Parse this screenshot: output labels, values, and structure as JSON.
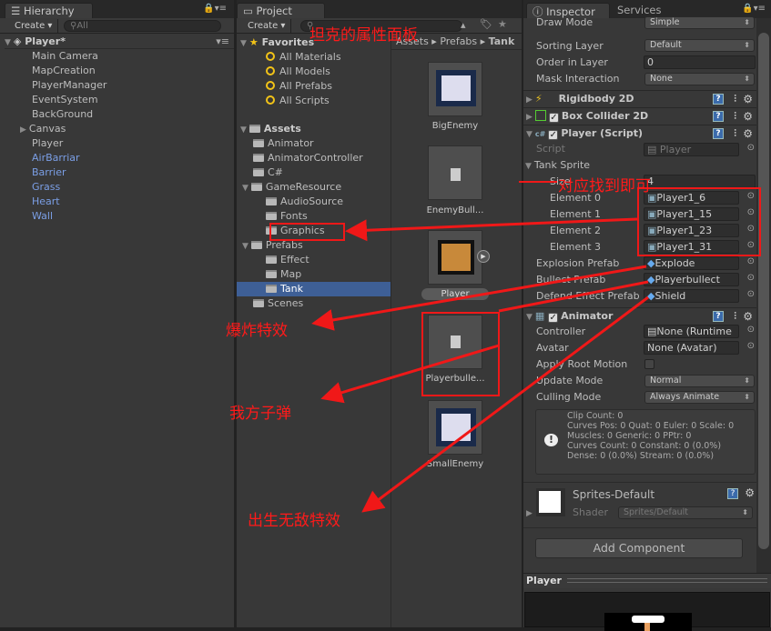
{
  "hierarchy": {
    "tab": "Hierarchy",
    "create": "Create ▾",
    "search_placeholder": "All",
    "scene": "Player*",
    "items": [
      {
        "label": "Main Camera"
      },
      {
        "label": "MapCreation"
      },
      {
        "label": "PlayerManager"
      },
      {
        "label": "EventSystem"
      },
      {
        "label": "BackGround"
      },
      {
        "label": "Canvas",
        "expandable": true
      },
      {
        "label": "Player"
      },
      {
        "label": "AirBarriar",
        "prefab": true
      },
      {
        "label": "Barrier",
        "prefab": true
      },
      {
        "label": "Grass",
        "prefab": true
      },
      {
        "label": "Heart",
        "prefab": true
      },
      {
        "label": "Wall",
        "prefab": true
      }
    ]
  },
  "project": {
    "tab": "Project",
    "create": "Create ▾",
    "favorites": {
      "label": "Favorites",
      "items": [
        "All Materials",
        "All Models",
        "All Prefabs",
        "All Scripts"
      ]
    },
    "assets": {
      "label": "Assets",
      "items": [
        "Animator",
        "AnimatorController",
        "C#",
        "GameResource",
        "AudioSource",
        "Fonts",
        "Graphics",
        "Prefabs",
        "Effect",
        "Map",
        "Tank",
        "Scenes"
      ]
    },
    "selected": "Tank",
    "breadcrumb": [
      "Assets",
      "Prefabs",
      "Tank"
    ],
    "grid": [
      "BigEnemy",
      "EnemyBull...",
      "Player",
      "Playerbulle...",
      "SmallEnemy"
    ]
  },
  "inspector": {
    "tabs": [
      "Inspector",
      "Services"
    ],
    "sprite_renderer": {
      "draw_mode_label": "Draw Mode",
      "draw_mode": "Simple",
      "sorting_layer_label": "Sorting Layer",
      "sorting_layer": "Default",
      "order_label": "Order in Layer",
      "order": "0",
      "mask_label": "Mask Interaction",
      "mask": "None"
    },
    "components": {
      "rigidbody": "Rigidbody 2D",
      "box_collider": "Box Collider 2D",
      "player_script": "Player (Script)",
      "animator": "Animator"
    },
    "player": {
      "script_label": "Script",
      "script": "Player",
      "tank_sprite_label": "Tank Sprite",
      "size_label": "Size",
      "size": "4",
      "elements": [
        {
          "label": "Element 0",
          "value": "Player1_6"
        },
        {
          "label": "Element 1",
          "value": "Player1_15"
        },
        {
          "label": "Element 2",
          "value": "Player1_23"
        },
        {
          "label": "Element 3",
          "value": "Player1_31"
        }
      ],
      "explosion_label": "Explosion Prefab",
      "explosion": "Explode",
      "bullet_label": "Bullect Prefab",
      "bullet": "Playerbullect",
      "defend_label": "Defend Effect Prefab",
      "defend": "Shield"
    },
    "animator": {
      "controller_label": "Controller",
      "controller": "None (Runtime",
      "avatar_label": "Avatar",
      "avatar": "None (Avatar)",
      "root_motion_label": "Apply Root Motion",
      "root_motion": false,
      "update_label": "Update Mode",
      "update": "Normal",
      "culling_label": "Culling Mode",
      "culling": "Always Animate",
      "info": [
        "Clip Count: 0",
        "Curves Pos: 0 Quat: 0 Euler: 0 Scale: 0",
        "Muscles: 0 Generic: 0 PPtr: 0",
        "Curves Count: 0 Constant: 0 (0.0%)",
        "Dense: 0 (0.0%) Stream: 0 (0.0%)"
      ]
    },
    "material": {
      "name": "Sprites-Default",
      "shader_label": "Shader",
      "shader": "Sprites/Default"
    },
    "add_component": "Add Component",
    "preview_title": "Player"
  },
  "annotations": {
    "panel": "坦克的属性面板",
    "find": "对应找到即可",
    "explode": "爆炸特效",
    "bullet": "我方子弹",
    "shield": "出生无敌特效"
  },
  "colors": {
    "annotation": "#ff1a1a",
    "selection": "#3e5f96",
    "prefab_text": "#7b9fe6"
  }
}
